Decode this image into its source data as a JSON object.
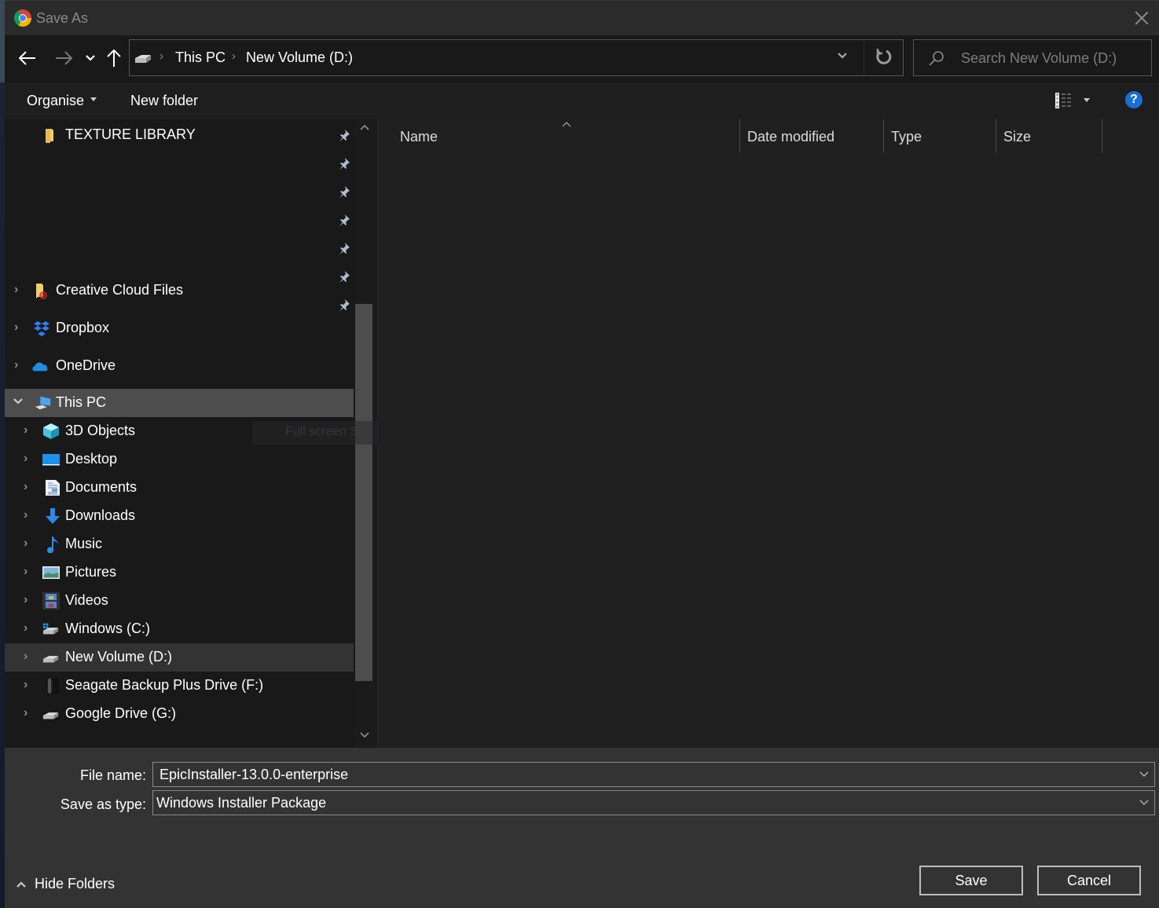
{
  "window": {
    "title": "Save As",
    "app_icon": "chrome-icon"
  },
  "nav": {
    "back": "back-icon",
    "forward": "forward-icon",
    "recent": "recent-locations-icon",
    "up": "up-icon",
    "breadcrumbs": [
      "This PC",
      "New Volume (D:)"
    ],
    "breadcrumb_separator": "›",
    "search_placeholder": "Search New Volume (D:)"
  },
  "toolbar": {
    "organise_label": "Organise",
    "new_folder_label": "New folder",
    "help_label": "?"
  },
  "sidebar": {
    "quick_access_pinned": [
      {
        "label": "TEXTURE LIBRARY",
        "icon": "folder-icon",
        "pinned": true
      },
      {
        "label": "",
        "icon": "",
        "pinned": true
      },
      {
        "label": "",
        "icon": "",
        "pinned": true
      },
      {
        "label": "",
        "icon": "",
        "pinned": true
      },
      {
        "label": "",
        "icon": "",
        "pinned": true
      },
      {
        "label": "",
        "icon": "",
        "pinned": true
      },
      {
        "label": "",
        "icon": "",
        "pinned": true
      }
    ],
    "items": [
      {
        "label": "Creative Cloud Files",
        "icon": "creative-cloud-folder-icon",
        "level": 0,
        "expanded": false
      },
      {
        "label": "Dropbox",
        "icon": "dropbox-icon",
        "level": 0,
        "expanded": false
      },
      {
        "label": "OneDrive",
        "icon": "onedrive-icon",
        "level": 0,
        "expanded": false
      },
      {
        "label": "This PC",
        "icon": "this-pc-icon",
        "level": 0,
        "expanded": true,
        "selected": true
      },
      {
        "label": "3D Objects",
        "icon": "3d-objects-icon",
        "level": 1
      },
      {
        "label": "Desktop",
        "icon": "desktop-icon",
        "level": 1
      },
      {
        "label": "Documents",
        "icon": "documents-icon",
        "level": 1
      },
      {
        "label": "Downloads",
        "icon": "downloads-icon",
        "level": 1
      },
      {
        "label": "Music",
        "icon": "music-icon",
        "level": 1
      },
      {
        "label": "Pictures",
        "icon": "pictures-icon",
        "level": 1
      },
      {
        "label": "Videos",
        "icon": "videos-icon",
        "level": 1
      },
      {
        "label": "Windows (C:)",
        "icon": "windows-drive-icon",
        "level": 1
      },
      {
        "label": "New Volume (D:)",
        "icon": "drive-icon",
        "level": 1,
        "hover": true
      },
      {
        "label": "Seagate Backup Plus Drive (F:)",
        "icon": "external-drive-icon",
        "level": 1
      },
      {
        "label": "Google Drive (G:)",
        "icon": "drive-icon",
        "level": 1
      }
    ],
    "ghost_tooltip": "Full screen Sni"
  },
  "content": {
    "columns": [
      "Name",
      "Date modified",
      "Type",
      "Size"
    ],
    "sort_column": "Name",
    "sort_direction": "ascending",
    "rows": []
  },
  "bottom": {
    "file_name_label": "File name:",
    "file_name_value": "EpicInstaller-13.0.0-enterprise",
    "save_as_type_label": "Save as type:",
    "save_as_type_value": "Windows Installer Package",
    "hide_folders_label": "Hide Folders",
    "save_label": "Save",
    "cancel_label": "Cancel"
  },
  "colors": {
    "help_blue": "#1a6ed4",
    "selected_row": "#4d4d4d",
    "hover_row": "#333333",
    "dialog_bg": "#1c1c1c",
    "bottom_bg": "#333333"
  }
}
